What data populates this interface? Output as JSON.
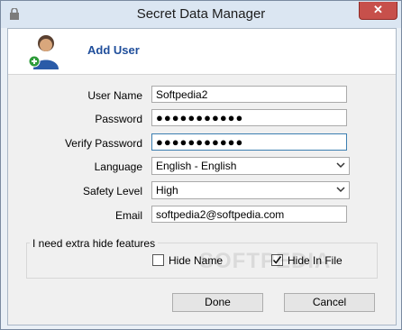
{
  "window": {
    "title": "Secret Data Manager",
    "close_label": "✕"
  },
  "header": {
    "title": "Add User"
  },
  "form": {
    "username": {
      "label": "User Name",
      "value": "Softpedia2"
    },
    "password": {
      "label": "Password",
      "value": "●●●●●●●●●●●"
    },
    "verify": {
      "label": "Verify Password",
      "value": "●●●●●●●●●●●"
    },
    "language": {
      "label": "Language",
      "value": "English - English"
    },
    "safety": {
      "label": "Safety Level",
      "value": "High"
    },
    "email": {
      "label": "Email",
      "value": "softpedia2@softpedia.com"
    }
  },
  "extra": {
    "legend": "I need extra hide features",
    "hide_name": {
      "label": "Hide Name",
      "checked": false
    },
    "hide_in_file": {
      "label": "Hide In File",
      "checked": true
    }
  },
  "buttons": {
    "done": "Done",
    "cancel": "Cancel"
  },
  "watermark": "SOFTPEDIA"
}
